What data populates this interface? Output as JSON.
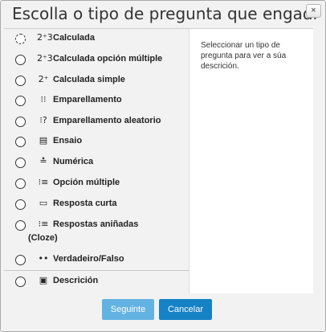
{
  "dialog": {
    "title": "Escolla o tipo de pregunta que engadir",
    "close_icon": "×"
  },
  "options": [
    {
      "label": "Calculada",
      "icon": "2⁺3",
      "icon_name": "calculated-icon"
    },
    {
      "label": "Calculada opción múltiple",
      "icon": "2⁺3",
      "icon_name": "calculated-multichoice-icon"
    },
    {
      "label": "Calculada simple",
      "icon": "2⁺",
      "icon_name": "calculated-simple-icon"
    },
    {
      "label": "Emparellamento",
      "icon": "⁝⁝",
      "icon_name": "matching-icon"
    },
    {
      "label": "Emparellamento aleatorio",
      "icon": "⁝?",
      "icon_name": "random-matching-icon"
    },
    {
      "label": "Ensaio",
      "icon": "▤",
      "icon_name": "essay-icon"
    },
    {
      "label": "Numérica",
      "icon": "≛",
      "icon_name": "numerical-icon"
    },
    {
      "label": "Opción múltiple",
      "icon": "⁝≡",
      "icon_name": "multichoice-icon"
    },
    {
      "label": "Resposta curta",
      "icon": "▭",
      "icon_name": "short-answer-icon"
    },
    {
      "label": "Respostas aniñadas",
      "label_line2": "(Cloze)",
      "icon": "⁝≡",
      "icon_name": "cloze-icon"
    },
    {
      "label": "Verdadeiro/Falso",
      "icon": "••",
      "icon_name": "truefalse-icon"
    },
    {
      "label": "Descrición",
      "icon": "▣",
      "icon_name": "description-icon"
    }
  ],
  "description_text": "Seleccionar un tipo de pregunta para ver a súa descrición.",
  "buttons": {
    "submit": "Seguinte",
    "cancel": "Cancelar"
  }
}
